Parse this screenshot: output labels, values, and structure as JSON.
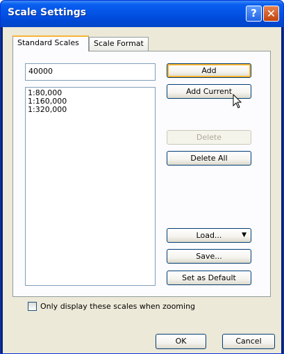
{
  "window": {
    "title": "Scale Settings",
    "help_label": "?",
    "close_label": "✕"
  },
  "tabs": [
    {
      "label": "Standard Scales",
      "active": true
    },
    {
      "label": "Scale Format",
      "active": false
    }
  ],
  "scale_input": {
    "value": "40000"
  },
  "scale_list": {
    "items": [
      "1:80,000",
      "1:160,000",
      "1:320,000"
    ]
  },
  "buttons": {
    "add": "Add",
    "add_current": "Add Current",
    "delete": "Delete",
    "delete_all": "Delete All",
    "load": "Load...",
    "save": "Save...",
    "set_default": "Set as Default",
    "ok": "OK",
    "cancel": "Cancel"
  },
  "options": {
    "only_display_label": "Only display these scales when zooming",
    "only_display_checked": false
  },
  "colors": {
    "titlebar": "#0054e3",
    "face": "#ece9d8",
    "tab_accent": "#f7b438"
  }
}
